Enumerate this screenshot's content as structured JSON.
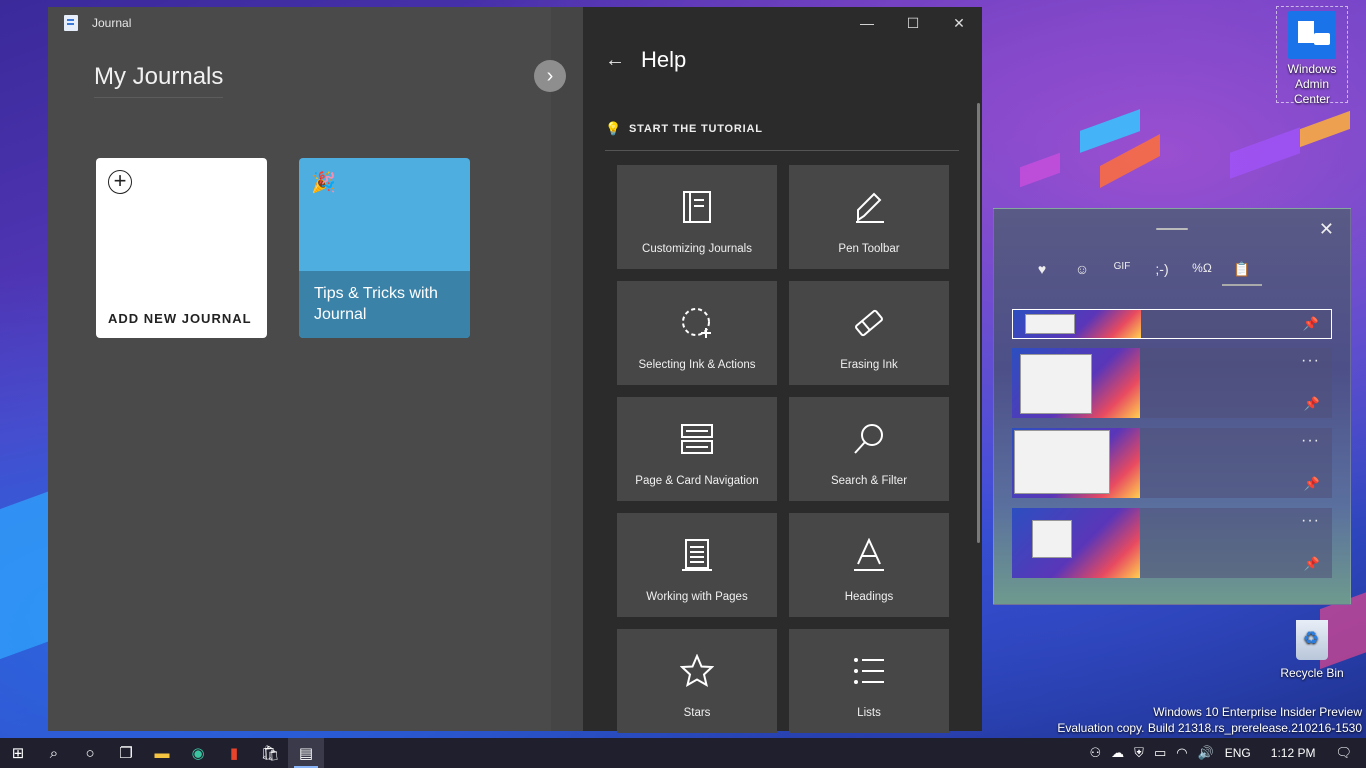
{
  "desktop": {
    "icons": [
      {
        "label_lines": [
          "Windows",
          "Admin",
          "Center"
        ]
      },
      {
        "label_lines": [
          "Recycle Bin"
        ]
      }
    ],
    "watermark": {
      "line1": "Windows 10 Enterprise Insider Preview",
      "line2": "Evaluation copy. Build 21318.rs_prerelease.210216-1530"
    }
  },
  "journal": {
    "app_title": "Journal",
    "section_title": "My Journals",
    "cards": {
      "add_new": "ADD NEW JOURNAL",
      "tips": "Tips & Tricks with Journal"
    },
    "help": {
      "title": "Help",
      "tutorial": "START THE TUTORIAL",
      "tiles": [
        {
          "label": "Customizing Journals",
          "icon": "notebook-icon"
        },
        {
          "label": "Pen Toolbar",
          "icon": "pen-icon"
        },
        {
          "label": "Selecting Ink & Actions",
          "icon": "lasso-icon"
        },
        {
          "label": "Erasing Ink",
          "icon": "eraser-icon"
        },
        {
          "label": "Page & Card Navigation",
          "icon": "cards-icon"
        },
        {
          "label": "Search & Filter",
          "icon": "search-icon"
        },
        {
          "label": "Working with Pages",
          "icon": "page-icon"
        },
        {
          "label": "Headings",
          "icon": "heading-icon"
        },
        {
          "label": "Stars",
          "icon": "star-icon"
        },
        {
          "label": "Lists",
          "icon": "list-icon"
        }
      ]
    }
  },
  "clipboard": {
    "tabs": [
      "heart-icon",
      "emoji-icon",
      "gif-icon",
      "kaomoji-icon",
      "symbols-icon",
      "clipboard-icon"
    ],
    "tab_glyphs": [
      "♥",
      "☺",
      "GIF",
      ";-)",
      "%Ω",
      "📋"
    ],
    "items_count": 4
  },
  "taskbar": {
    "apps": [
      "start-icon",
      "search-icon",
      "cortana-icon",
      "task-view-icon",
      "file-explorer-icon",
      "edge-icon",
      "office-icon",
      "store-icon",
      "journal-icon"
    ],
    "language": "ENG",
    "time": "1:12 PM"
  }
}
